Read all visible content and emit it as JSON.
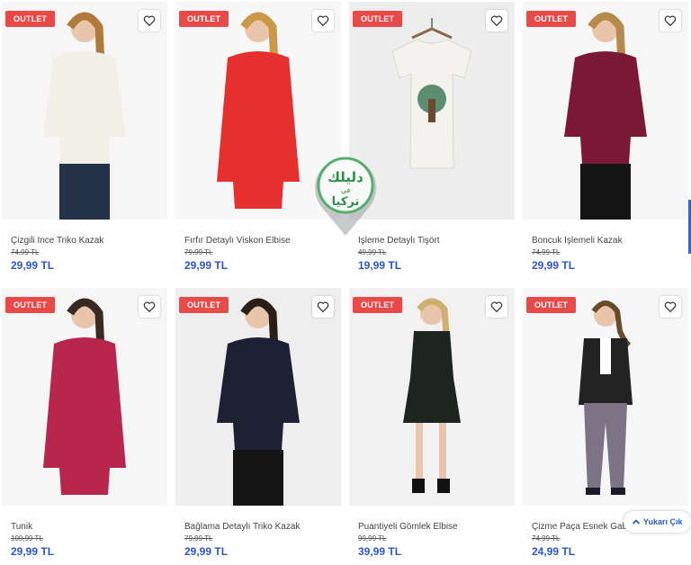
{
  "badge_label": "OUTLET",
  "scroll_top_label": "Yukarı Çık",
  "watermark_text": [
    "دليلك",
    "في",
    "تركيا"
  ],
  "colors": {
    "badge": "#e84a4a",
    "price": "#2b57c9"
  },
  "products": [
    {
      "name": "Çizgili İnce Triko Kazak",
      "old_price": "74,99 TL",
      "price": "29,99 TL",
      "garment": "#f1efe6",
      "bg": "#f6f6f6"
    },
    {
      "name": "Fırfır Detaylı Viskon Elbise",
      "old_price": "79,99 TL",
      "price": "29,99 TL",
      "garment": "#e5302d",
      "bg": "#f7f7f7"
    },
    {
      "name": "İşleme Detaylı Tişört",
      "old_price": "49,99 TL",
      "price": "19,99 TL",
      "garment": "#f4f2ee",
      "bg": "#ededed"
    },
    {
      "name": "Boncuk İşlemeli Kazak",
      "old_price": "74,99 TL",
      "price": "29,99 TL",
      "garment": "#7a1836",
      "bg": "#f6f6f6"
    },
    {
      "name": "Tunik",
      "old_price": "109,99 TL",
      "price": "29,99 TL",
      "garment": "#b8264d",
      "bg": "#f6f6f6"
    },
    {
      "name": "Bağlama Detaylı Triko Kazak",
      "old_price": "79,99 TL",
      "price": "29,99 TL",
      "garment": "#1d2133",
      "bg": "#eeeeee"
    },
    {
      "name": "Puantiyeli Gömlek Elbise",
      "old_price": "99,99 TL",
      "price": "39,99 TL",
      "garment": "#1e2520",
      "bg": "#f1f1f1"
    },
    {
      "name": "Çizme Paça Esnek Gabardin",
      "old_price": "74,99 TL",
      "price": "24,99 TL",
      "garment": "#232323",
      "bg": "#f6f6f6"
    }
  ]
}
